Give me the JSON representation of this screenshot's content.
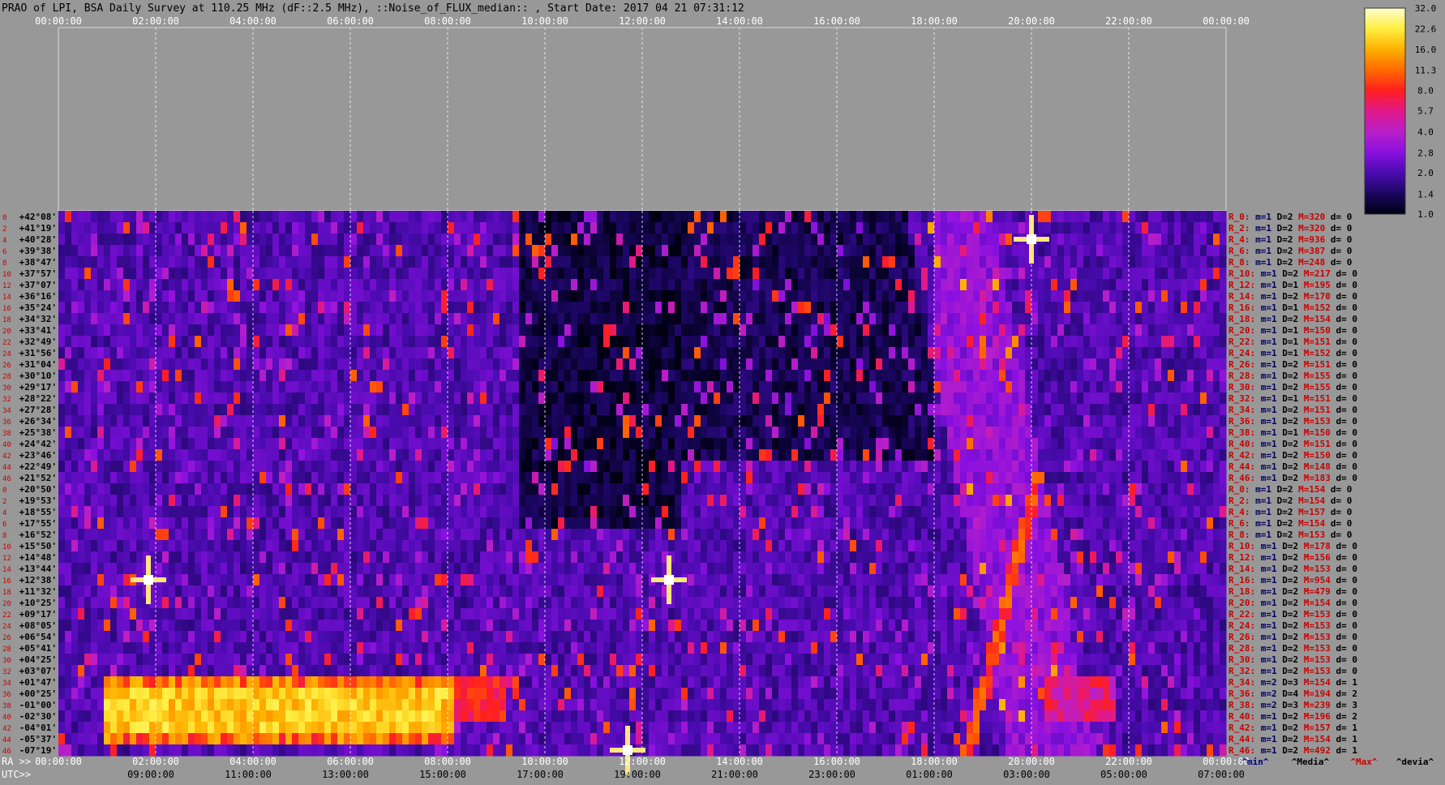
{
  "title": "PRAO of LPI, BSA Daily Survey at 110.25 MHz (dF::2.5 MHz), ::Noise_of_FLUX_median:: , Start Date: 2017 04 21 07:31:12",
  "chart_data": {
    "type": "heatmap",
    "title": "PRAO of LPI, BSA Daily Survey at 110.25 MHz (dF::2.5 MHz), ::Noise_of_FLUX_median:: , Start Date: 2017 04 21 07:31:12",
    "x_top_ticks": [
      "00:00:00",
      "02:00:00",
      "04:00:00",
      "06:00:00",
      "08:00:00",
      "10:00:00",
      "12:00:00",
      "14:00:00",
      "16:00:00",
      "18:00:00",
      "20:00:00",
      "22:00:00",
      "00:00:00"
    ],
    "x_ra_label": "RA >>",
    "x_ra_ticks": [
      "00:00:00",
      "02:00:00",
      "04:00:00",
      "06:00:00",
      "08:00:00",
      "10:00:00",
      "12:00:00",
      "14:00:00",
      "16:00:00",
      "18:00:00",
      "20:00:00",
      "22:00:00",
      "00:00:00"
    ],
    "x_utc_label": "UTC>>",
    "x_utc_ticks": [
      "09:00:00",
      "11:00:00",
      "13:00:00",
      "15:00:00",
      "17:00:00",
      "19:00:00",
      "21:00:00",
      "23:00:00",
      "01:00:00",
      "03:00:00",
      "05:00:00",
      "07:00:00"
    ],
    "x_range_hours": [
      0,
      24
    ],
    "y_labels": [
      "+42°08'",
      "+41°19'",
      "+40°28'",
      "+39°38'",
      "+38°47'",
      "+37°57'",
      "+37°07'",
      "+36°16'",
      "+35°24'",
      "+34°32'",
      "+33°41'",
      "+32°49'",
      "+31°56'",
      "+31°04'",
      "+30°10'",
      "+29°17'",
      "+28°22'",
      "+27°28'",
      "+26°34'",
      "+25°38'",
      "+24°42'",
      "+23°46'",
      "+22°49'",
      "+21°52'",
      "+20°50'",
      "+19°53'",
      "+18°55'",
      "+17°55'",
      "+16°52'",
      "+15°50'",
      "+14°48'",
      "+13°44'",
      "+12°38'",
      "+11°32'",
      "+10°25'",
      "+09°17'",
      "+08°05'",
      "+06°54'",
      "+05°41'",
      "+04°25'",
      "+03°07'",
      "+01°47'",
      "+00°25'",
      "-01°00'",
      "-02°30'",
      "-04°01'",
      "-05°37'",
      "-07°19'"
    ],
    "row_numbers": [
      "0",
      "2",
      "4",
      "6",
      "8",
      "10",
      "12",
      "14",
      "16",
      "18",
      "20",
      "22",
      "24",
      "26",
      "28",
      "30",
      "32",
      "34",
      "36",
      "38",
      "40",
      "42",
      "44",
      "46",
      "0",
      "2",
      "4",
      "6",
      "8",
      "10",
      "12",
      "14",
      "16",
      "18",
      "20",
      "22",
      "24",
      "26",
      "28",
      "30",
      "32",
      "34",
      "36",
      "38",
      "40",
      "42",
      "44",
      "46"
    ],
    "row_stats": [
      {
        "r": "R_0:",
        "m": "m=1",
        "d": "D=2",
        "M": "M=320",
        "dv": "d= 0"
      },
      {
        "r": "R_2:",
        "m": "m=1",
        "d": "D=2",
        "M": "M=320",
        "dv": "d= 0"
      },
      {
        "r": "R_4:",
        "m": "m=1",
        "d": "D=2",
        "M": "M=936",
        "dv": "d= 0"
      },
      {
        "r": "R_6:",
        "m": "m=1",
        "d": "D=2",
        "M": "M=387",
        "dv": "d= 0"
      },
      {
        "r": "R_8:",
        "m": "m=1",
        "d": "D=2",
        "M": "M=248",
        "dv": "d= 0"
      },
      {
        "r": "R_10:",
        "m": "m=1",
        "d": "D=2",
        "M": "M=217",
        "dv": "d= 0"
      },
      {
        "r": "R_12:",
        "m": "m=1",
        "d": "D=1",
        "M": "M=195",
        "dv": "d= 0"
      },
      {
        "r": "R_14:",
        "m": "m=1",
        "d": "D=2",
        "M": "M=170",
        "dv": "d= 0"
      },
      {
        "r": "R_16:",
        "m": "m=1",
        "d": "D=1",
        "M": "M=152",
        "dv": "d= 0"
      },
      {
        "r": "R_18:",
        "m": "m=1",
        "d": "D=2",
        "M": "M=154",
        "dv": "d= 0"
      },
      {
        "r": "R_20:",
        "m": "m=1",
        "d": "D=1",
        "M": "M=150",
        "dv": "d= 0"
      },
      {
        "r": "R_22:",
        "m": "m=1",
        "d": "D=1",
        "M": "M=151",
        "dv": "d= 0"
      },
      {
        "r": "R_24:",
        "m": "m=1",
        "d": "D=1",
        "M": "M=152",
        "dv": "d= 0"
      },
      {
        "r": "R_26:",
        "m": "m=1",
        "d": "D=2",
        "M": "M=151",
        "dv": "d= 0"
      },
      {
        "r": "R_28:",
        "m": "m=1",
        "d": "D=2",
        "M": "M=155",
        "dv": "d= 0"
      },
      {
        "r": "R_30:",
        "m": "m=1",
        "d": "D=2",
        "M": "M=155",
        "dv": "d= 0"
      },
      {
        "r": "R_32:",
        "m": "m=1",
        "d": "D=1",
        "M": "M=151",
        "dv": "d= 0"
      },
      {
        "r": "R_34:",
        "m": "m=1",
        "d": "D=2",
        "M": "M=151",
        "dv": "d= 0"
      },
      {
        "r": "R_36:",
        "m": "m=1",
        "d": "D=2",
        "M": "M=153",
        "dv": "d= 0"
      },
      {
        "r": "R_38:",
        "m": "m=1",
        "d": "D=1",
        "M": "M=150",
        "dv": "d= 0"
      },
      {
        "r": "R_40:",
        "m": "m=1",
        "d": "D=2",
        "M": "M=151",
        "dv": "d= 0"
      },
      {
        "r": "R_42:",
        "m": "m=1",
        "d": "D=2",
        "M": "M=150",
        "dv": "d= 0"
      },
      {
        "r": "R_44:",
        "m": "m=1",
        "d": "D=2",
        "M": "M=148",
        "dv": "d= 0"
      },
      {
        "r": "R_46:",
        "m": "m=1",
        "d": "D=2",
        "M": "M=183",
        "dv": "d= 0"
      },
      {
        "r": "R_0:",
        "m": "m=1",
        "d": "D=2",
        "M": "M=154",
        "dv": "d= 0"
      },
      {
        "r": "R_2:",
        "m": "m=1",
        "d": "D=2",
        "M": "M=154",
        "dv": "d= 0"
      },
      {
        "r": "R_4:",
        "m": "m=1",
        "d": "D=2",
        "M": "M=157",
        "dv": "d= 0"
      },
      {
        "r": "R_6:",
        "m": "m=1",
        "d": "D=2",
        "M": "M=154",
        "dv": "d= 0"
      },
      {
        "r": "R_8:",
        "m": "m=1",
        "d": "D=2",
        "M": "M=153",
        "dv": "d= 0"
      },
      {
        "r": "R_10:",
        "m": "m=1",
        "d": "D=2",
        "M": "M=178",
        "dv": "d= 0"
      },
      {
        "r": "R_12:",
        "m": "m=1",
        "d": "D=2",
        "M": "M=156",
        "dv": "d= 0"
      },
      {
        "r": "R_14:",
        "m": "m=1",
        "d": "D=2",
        "M": "M=153",
        "dv": "d= 0"
      },
      {
        "r": "R_16:",
        "m": "m=1",
        "d": "D=2",
        "M": "M=954",
        "dv": "d= 0"
      },
      {
        "r": "R_18:",
        "m": "m=1",
        "d": "D=2",
        "M": "M=479",
        "dv": "d= 0"
      },
      {
        "r": "R_20:",
        "m": "m=1",
        "d": "D=2",
        "M": "M=154",
        "dv": "d= 0"
      },
      {
        "r": "R_22:",
        "m": "m=1",
        "d": "D=2",
        "M": "M=153",
        "dv": "d= 0"
      },
      {
        "r": "R_24:",
        "m": "m=1",
        "d": "D=2",
        "M": "M=153",
        "dv": "d= 0"
      },
      {
        "r": "R_26:",
        "m": "m=1",
        "d": "D=2",
        "M": "M=153",
        "dv": "d= 0"
      },
      {
        "r": "R_28:",
        "m": "m=1",
        "d": "D=2",
        "M": "M=153",
        "dv": "d= 0"
      },
      {
        "r": "R_30:",
        "m": "m=1",
        "d": "D=2",
        "M": "M=153",
        "dv": "d= 0"
      },
      {
        "r": "R_32:",
        "m": "m=1",
        "d": "D=2",
        "M": "M=153",
        "dv": "d= 0"
      },
      {
        "r": "R_34:",
        "m": "m=2",
        "d": "D=3",
        "M": "M=154",
        "dv": "d= 1"
      },
      {
        "r": "R_36:",
        "m": "m=2",
        "d": "D=4",
        "M": "M=194",
        "dv": "d= 2"
      },
      {
        "r": "R_38:",
        "m": "m=2",
        "d": "D=3",
        "M": "M=239",
        "dv": "d= 3"
      },
      {
        "r": "R_40:",
        "m": "m=1",
        "d": "D=2",
        "M": "M=196",
        "dv": "d= 2"
      },
      {
        "r": "R_42:",
        "m": "m=1",
        "d": "D=2",
        "M": "M=157",
        "dv": "d= 1"
      },
      {
        "r": "R_44:",
        "m": "m=1",
        "d": "D=2",
        "M": "M=154",
        "dv": "d= 1"
      },
      {
        "r": "R_46:",
        "m": "m=1",
        "d": "D=2",
        "M": "M=492",
        "dv": "d= 1"
      }
    ],
    "stats_footer": {
      "min": "^min^",
      "median": "^Media^",
      "max": "^Max^",
      "devia": "^devia^"
    },
    "colorbar": {
      "ticks": [
        "32.0",
        "22.6",
        "16.0",
        "11.3",
        "8.0",
        "5.7",
        "4.0",
        "2.8",
        "2.0",
        "1.4",
        "1.0"
      ],
      "scale": "log",
      "range": [
        1.0,
        32.0
      ],
      "colors": [
        "#000012",
        "#1a0660",
        "#4b0bb0",
        "#8a10e0",
        "#b81fc8",
        "#e0188a",
        "#ff1f1f",
        "#ff6a00",
        "#ffb000",
        "#ffee40",
        "#ffffd0"
      ]
    },
    "bright_sources": [
      {
        "ra_hours": 1.85,
        "row": 32
      },
      {
        "ra_hours": 20.0,
        "row": 2
      },
      {
        "ra_hours": 11.7,
        "row": 47
      },
      {
        "ra_hours": 12.55,
        "row": 32
      }
    ],
    "grid": true
  }
}
